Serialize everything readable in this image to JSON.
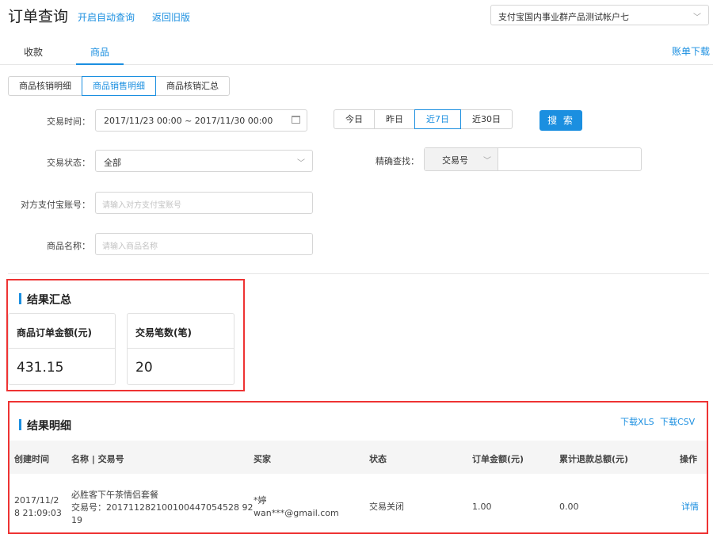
{
  "header": {
    "title": "订单查询",
    "auto_query_link": "开启自动查询",
    "old_version_link": "返回旧版",
    "account_selected": "支付宝国内事业群产品测试帐户七"
  },
  "main_tabs": [
    {
      "label": "收款",
      "active": false
    },
    {
      "label": "商品",
      "active": true
    }
  ],
  "bill_download": "账单下载",
  "sub_tabs": [
    {
      "label": "商品核销明细",
      "active": false
    },
    {
      "label": "商品销售明细",
      "active": true
    },
    {
      "label": "商品核销汇总",
      "active": false
    }
  ],
  "filters": {
    "time_label": "交易时间：",
    "time_range": "2017/11/23 00:00  ~  2017/11/30 00:00",
    "quick_range": [
      {
        "label": "今日",
        "active": false
      },
      {
        "label": "昨日",
        "active": false
      },
      {
        "label": "近7日",
        "active": true
      },
      {
        "label": "近30日",
        "active": false
      }
    ],
    "search_button": "搜 索",
    "status_label": "交易状态：",
    "status_value": "全部",
    "precise_label": "精确查找：",
    "precise_field": "交易号",
    "precise_value": "",
    "counterparty_label": "对方支付宝账号：",
    "counterparty_placeholder": "请输入对方支付宝账号",
    "product_label": "商品名称：",
    "product_placeholder": "请输入商品名称"
  },
  "summary": {
    "title": "结果汇总",
    "cards": [
      {
        "label": "商品订单金额(元)",
        "value": "431.15"
      },
      {
        "label": "交易笔数(笔)",
        "value": "20"
      }
    ]
  },
  "details": {
    "title": "结果明细",
    "download_xls": "下载XLS",
    "download_csv": "下载CSV",
    "columns": [
      "创建时间",
      "名称 | 交易号",
      "买家",
      "状态",
      "订单金额(元)",
      "累计退款总额(元)",
      "操作"
    ],
    "rows": [
      {
        "created_line1": "2017/11/2",
        "created_line2": "8 21:09:03",
        "name": "必胜客下午茶情侣套餐",
        "trade_no_line1": "交易号：201711282100100447054528 92",
        "trade_no_line2": "19",
        "buyer_name": "*婷",
        "buyer_account": "wan***@gmail.com",
        "status": "交易关闭",
        "amount": "1.00",
        "refund": "0.00",
        "action": "详情"
      }
    ]
  },
  "colors": {
    "accent": "#1b8fe0",
    "highlight_box": "#ee3333"
  }
}
